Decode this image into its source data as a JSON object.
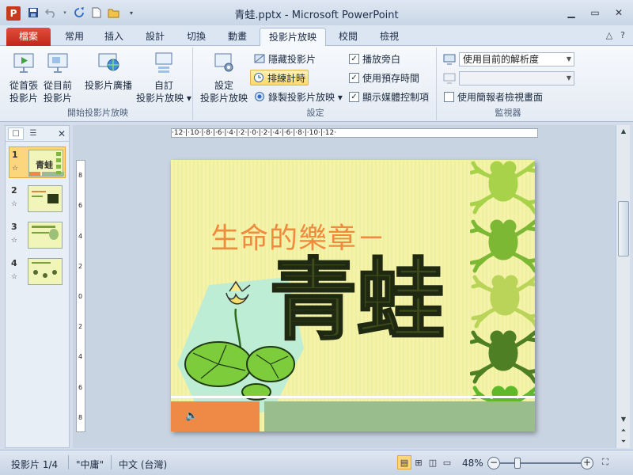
{
  "window": {
    "app_icon": "P",
    "title": "青蛙.pptx - Microsoft PowerPoint",
    "minimize": "▁",
    "maximize": "▭",
    "close": "✕"
  },
  "tabs": [
    {
      "label": "檔案"
    },
    {
      "label": "常用"
    },
    {
      "label": "插入"
    },
    {
      "label": "設計"
    },
    {
      "label": "切換"
    },
    {
      "label": "動畫"
    },
    {
      "label": "投影片放映"
    },
    {
      "label": "校閱"
    },
    {
      "label": "檢視"
    }
  ],
  "tab_right": {
    "collapse": "△",
    "help": "?"
  },
  "ribbon": {
    "start_group": {
      "label": "開始投影片放映",
      "from_beginning": "從首張\n投影片",
      "from_current": "從目前\n投影片",
      "broadcast": "投影片廣播",
      "custom": "自訂\n投影片放映 ▾"
    },
    "setup_group": {
      "label": "設定",
      "setup_show": "設定\n投影片放映",
      "hide_slide": "隱藏投影片",
      "rehearse": "排練計時",
      "record": "錄製投影片放映 ▾",
      "play_narrations": "播放旁白",
      "use_timings": "使用預存時間",
      "show_media_controls": "顯示媒體控制項"
    },
    "monitors_group": {
      "label": "監視器",
      "resolution": "使用目前的解析度",
      "show_on": "",
      "presenter_view": "使用簡報者檢視畫面"
    }
  },
  "left_pane": {
    "tab_slides": "□",
    "tab_outline": "☰",
    "close": "✕",
    "slides": [
      {
        "num": "1",
        "star": "☆",
        "thumb_text": "青蛙"
      },
      {
        "num": "2",
        "star": "☆",
        "thumb_text": ""
      },
      {
        "num": "3",
        "star": "☆",
        "thumb_text": ""
      },
      {
        "num": "4",
        "star": "☆",
        "thumb_text": ""
      }
    ]
  },
  "ruler": {
    "horizontal": "·12·|·10·|·8·|·6·|·4·|·2·|·0·|·2·|·4·|·6·|·8·|·10·|·12·",
    "vertical": [
      "8",
      "6",
      "4",
      "2",
      "0",
      "2",
      "4",
      "6",
      "8"
    ]
  },
  "slide": {
    "subtitle": "生命的樂章－",
    "title": "青蛙",
    "speaker_icon": "🔈"
  },
  "status": {
    "slide_info": "投影片 1/4",
    "theme": "\"中庸\"",
    "language": "中文 (台灣)",
    "zoom": "48%",
    "zoom_level_percent": 48
  },
  "colors": {
    "file_tab": "#c0281a",
    "subtitle": "#f08a3c",
    "title_fill": "#3b4a1c",
    "slide_bg": "#f5f3a9",
    "band_orange": "#ee8a45",
    "band_green": "#9abd8d"
  }
}
